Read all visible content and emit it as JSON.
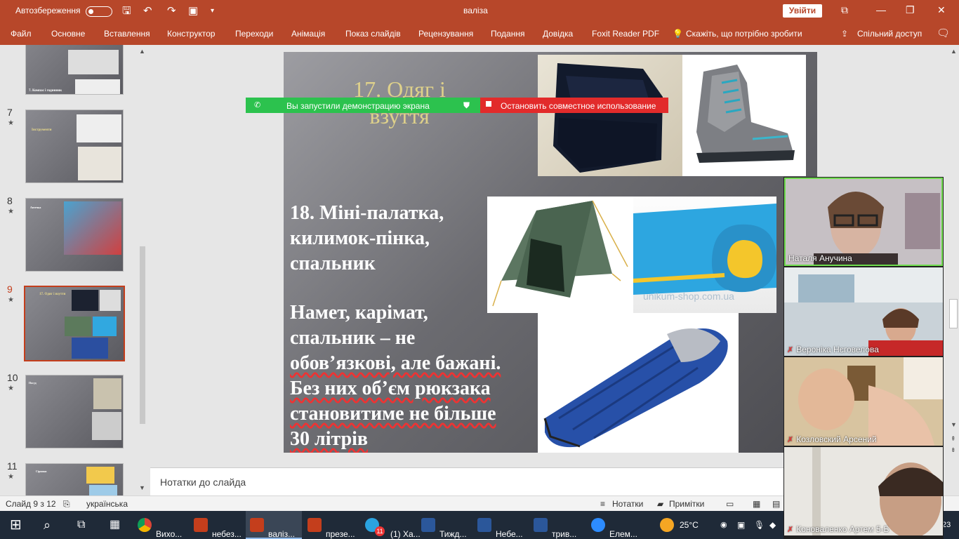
{
  "titlebar": {
    "autosave_label": "Автозбереження",
    "autosave_state": "off",
    "doc_title": "валіза",
    "signin_label": "Увійти"
  },
  "ribbon": {
    "tabs": [
      "Файл",
      "Основне",
      "Вставлення",
      "Конструктор",
      "Переходи",
      "Анімація",
      "Показ слайдів",
      "Рецензування",
      "Подання",
      "Довідка",
      "Foxit Reader PDF"
    ],
    "tell_me": "Скажіть, що потрібно зробити",
    "share": "Спільний доступ"
  },
  "thumbs": {
    "items": [
      {
        "num": "",
        "label": "7. Компас і годинник"
      },
      {
        "num": "7",
        "label": "Інструменти"
      },
      {
        "num": "8",
        "label": "Аптечка"
      },
      {
        "num": "9",
        "label": "17. Одяг і взуття",
        "selected": true
      },
      {
        "num": "10",
        "label": "Посуд"
      },
      {
        "num": "11",
        "label": "Сірники"
      }
    ]
  },
  "slide": {
    "title": "17. Одяг і взуття",
    "heading": "18. Міні-палатка, килимок-пінка, спальник",
    "body_lines": [
      "Намет, карімат,",
      "спальник – не",
      "обов’язкові, але бажані.",
      "Без них об’єм рюкзака",
      "становитиме не більше",
      "30 літрів"
    ],
    "watermark": "unikum-shop.com.ua"
  },
  "banner": {
    "sharing": "Вы запустили демонстрацию экрана",
    "stop": "Остановить совместное использование"
  },
  "notes": {
    "placeholder": "Нотатки до слайда"
  },
  "status": {
    "slide": "Слайд 9 з 12",
    "language": "українська",
    "notes_btn": "Нотатки",
    "comments_btn": "Примітки"
  },
  "participants": [
    {
      "name": "Наталя Анучина",
      "muted": false
    },
    {
      "name": "Вероніка Нєговелова",
      "muted": true
    },
    {
      "name": "Козловский Арсений",
      "muted": true
    },
    {
      "name": "Коноваленко Артем 5-Б",
      "muted": true
    }
  ],
  "taskbar": {
    "items": [
      {
        "label": "Вихо...",
        "color": "#db4437"
      },
      {
        "label": "небез...",
        "color": "#c43e1c"
      },
      {
        "label": "валіз...",
        "color": "#c43e1c"
      },
      {
        "label": "презе...",
        "color": "#c43e1c"
      },
      {
        "label": "(1) Ха...",
        "color": "#2aa3e0"
      },
      {
        "label": "Тижд...",
        "color": "#2b579a"
      },
      {
        "label": "Небе...",
        "color": "#2b579a"
      },
      {
        "label": "трив...",
        "color": "#2b579a"
      },
      {
        "label": "Елем...",
        "color": "#2d8cff"
      }
    ],
    "weather": "25°C",
    "telegram_badge": "11",
    "clock": "23"
  }
}
